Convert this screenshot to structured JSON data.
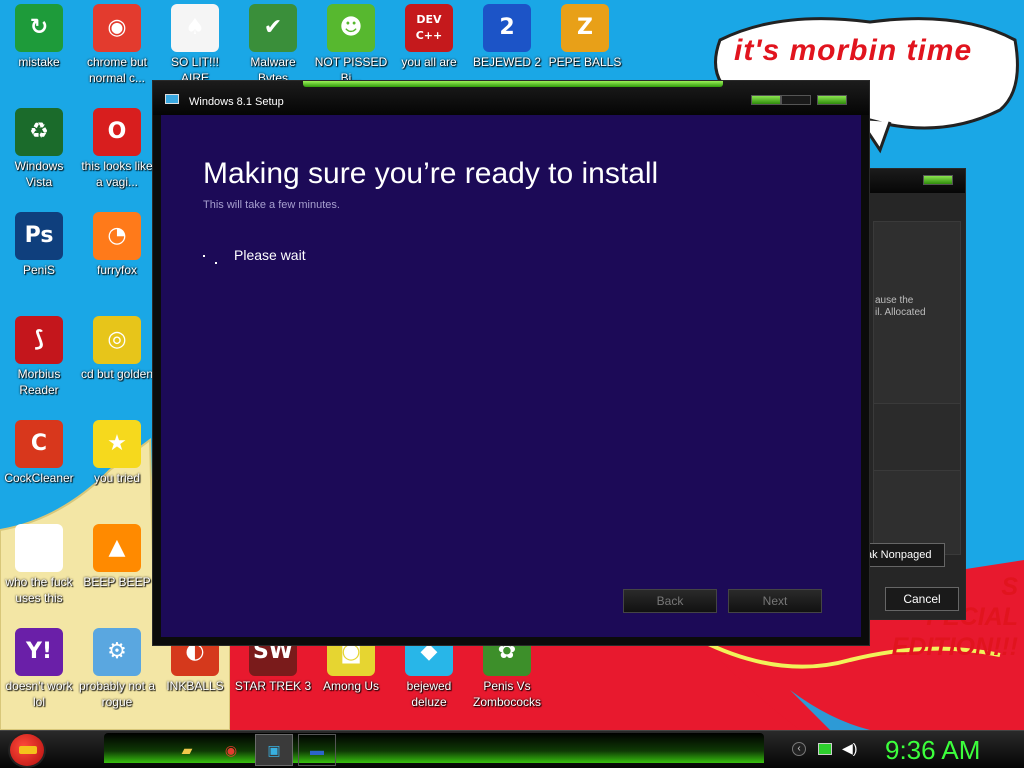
{
  "desktop": {
    "speech_text": "it's morbin time",
    "poster_text": "S\nPECIAL\nEDITION!!!",
    "icons": [
      {
        "label": "mistake",
        "glyph": "↻",
        "color": "#1e9b3a"
      },
      {
        "label": "chrome but normal c...",
        "glyph": "◉",
        "color": "#e33b2e"
      },
      {
        "label": "SO LIT!!! AIRE",
        "glyph": "♠",
        "color": "#f5f5f5"
      },
      {
        "label": "Malware Bytes",
        "glyph": "✔",
        "color": "#3a8f3a"
      },
      {
        "label": "NOT PISSED Bi...",
        "glyph": "☻",
        "color": "#57b82f"
      },
      {
        "label": "you all are",
        "glyph": "DEV C++",
        "color": "#c5191c"
      },
      {
        "label": "BEJEWED 2",
        "glyph": "2",
        "color": "#1c54c7"
      },
      {
        "label": "PEPE BALLS",
        "glyph": "Z",
        "color": "#e8a018"
      },
      {
        "label": "Windows Vista",
        "glyph": "♻",
        "color": "#1b6b2b"
      },
      {
        "label": "this looks like a vagi...",
        "glyph": "O",
        "color": "#d81e1e"
      },
      {
        "label": "PeniS",
        "glyph": "Ps",
        "color": "#0f3f7d"
      },
      {
        "label": "furryfox",
        "glyph": "◔",
        "color": "#ff7a1a"
      },
      {
        "label": "Morbius Reader",
        "glyph": "⟆",
        "color": "#c4161c"
      },
      {
        "label": "cd but golden",
        "glyph": "◎",
        "color": "#e7c51a"
      },
      {
        "label": "CockCleaner",
        "glyph": "C",
        "color": "#d8371c"
      },
      {
        "label": "you tried",
        "glyph": "★",
        "color": "#f6d91d"
      },
      {
        "label": "who the fuck uses this",
        "glyph": "⚡",
        "color": "#ffffff"
      },
      {
        "label": "BEEP BEEP",
        "glyph": "▲",
        "color": "#ff8a00"
      },
      {
        "label": "doesn't work lol",
        "glyph": "Y!",
        "color": "#6a1fa8"
      },
      {
        "label": "probably not a rogue",
        "glyph": "⚙",
        "color": "#5aa7e0"
      },
      {
        "label": "INKBALLS",
        "glyph": "◐",
        "color": "#d5391c"
      },
      {
        "label": "STAR TREK 3",
        "glyph": "SW",
        "color": "#7a1b1b"
      },
      {
        "label": "Among Us",
        "glyph": "◙",
        "color": "#e6d531"
      },
      {
        "label": "bejewed deluze",
        "glyph": "◆",
        "color": "#28b6e8"
      },
      {
        "label": "Penis Vs Zombococks",
        "glyph": "✿",
        "color": "#3d8f2a"
      }
    ]
  },
  "back_window": {
    "text": "ause the\nil. Allocated",
    "nonpaged_label": "ak Nonpaged",
    "cancel_label": "Cancel"
  },
  "setup": {
    "window_title": "Windows 8.1 Setup",
    "heading": "Making sure you’re ready to install",
    "subheading": "This will take a few minutes.",
    "status": "Please wait",
    "back_label": "Back",
    "next_label": "Next"
  },
  "taskbar": {
    "clock": "9:36 AM"
  }
}
